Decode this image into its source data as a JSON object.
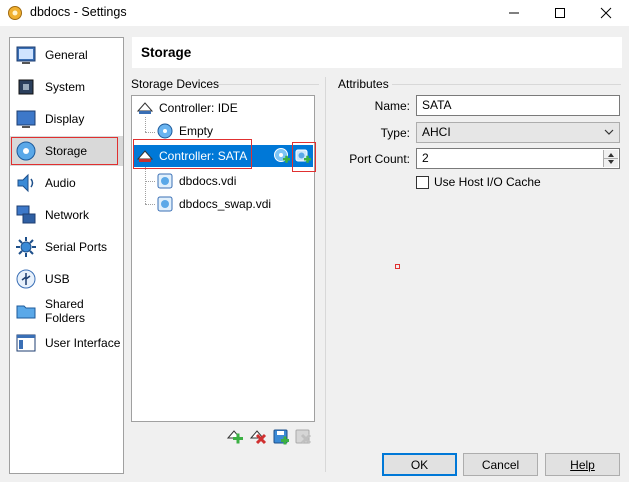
{
  "window": {
    "title": "dbdocs - Settings"
  },
  "sidebar": {
    "items": [
      {
        "label": "General"
      },
      {
        "label": "System"
      },
      {
        "label": "Display"
      },
      {
        "label": "Storage"
      },
      {
        "label": "Audio"
      },
      {
        "label": "Network"
      },
      {
        "label": "Serial Ports"
      },
      {
        "label": "USB"
      },
      {
        "label": "Shared Folders"
      },
      {
        "label": "User Interface"
      }
    ],
    "selected": "Storage"
  },
  "page": {
    "title": "Storage"
  },
  "storage_devices": {
    "label": "Storage Devices",
    "tree": [
      {
        "label": "Controller: IDE"
      },
      {
        "label": "Empty"
      },
      {
        "label": "Controller: SATA"
      },
      {
        "label": "dbdocs.vdi"
      },
      {
        "label": "dbdocs_swap.vdi"
      }
    ]
  },
  "attributes": {
    "label": "Attributes",
    "name_label": "Name:",
    "name_value": "SATA",
    "type_label": "Type:",
    "type_value": "AHCI",
    "port_count_label": "Port Count:",
    "port_count_value": "2",
    "host_cache_label": "Use Host I/O Cache",
    "host_cache_checked": false
  },
  "buttons": {
    "ok": "OK",
    "cancel": "Cancel",
    "help": "Help"
  },
  "colors": {
    "selection": "#0078d7",
    "highlight_outline": "#e03030"
  }
}
